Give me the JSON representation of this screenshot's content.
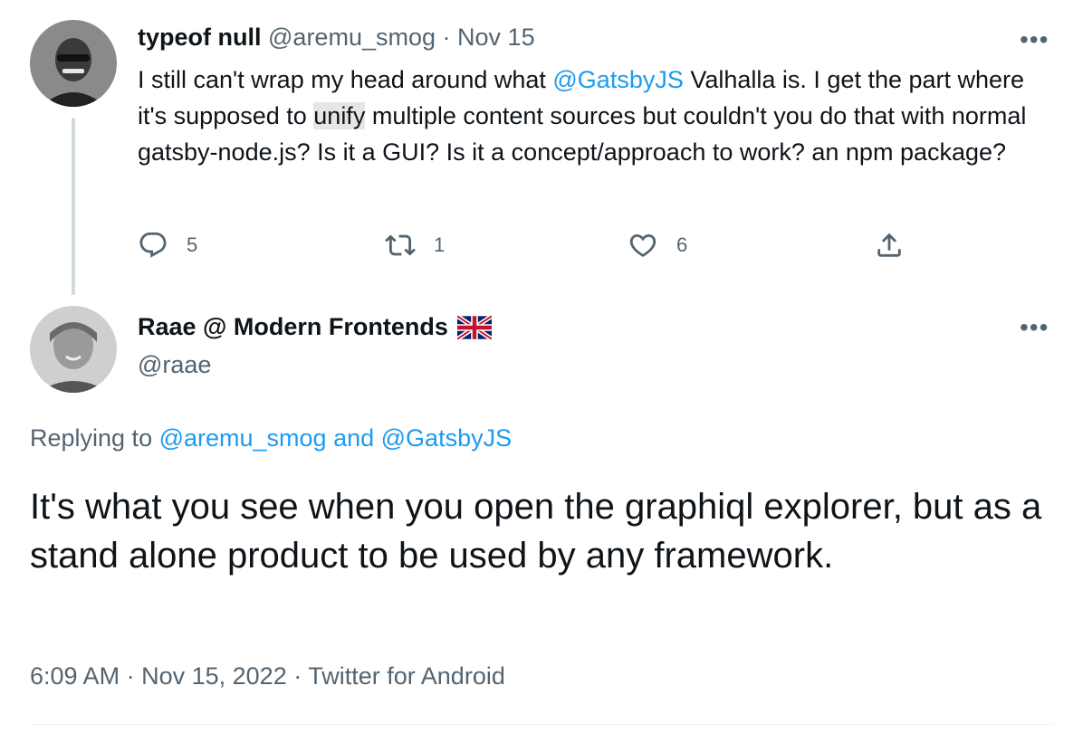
{
  "tweet1": {
    "author_name": "typeof null",
    "handle": "@aremu_smog",
    "separator": "·",
    "date": "Nov 15",
    "text_before": "I still can't wrap my head around what ",
    "mention": "@GatsbyJS",
    "text_mid": " Valhalla is. I get the part where it's supposed to ",
    "highlighted_word": "unify",
    "text_after": " multiple content sources but couldn't you do that with normal gatsby-node.js? Is it a GUI? Is it a concept/approach to work? an npm package?",
    "replies": "5",
    "retweets": "1",
    "likes": "6"
  },
  "tweet2": {
    "author_name": "Raae @ Modern Frontends",
    "flag": "🇬🇧",
    "handle": "@raae",
    "replying_prefix": "Replying to ",
    "replying_to_1": "@aremu_smog",
    "replying_and": " and ",
    "replying_to_2": "@GatsbyJS",
    "text": "It's what you see when you open the graphiql explorer, but as a stand alone product to be used by any framework.",
    "time": "6:09 AM",
    "separator": "·",
    "date": "Nov 15, 2022",
    "source": "Twitter for Android"
  },
  "more_menu": "•••",
  "icons": {
    "reply": "reply-icon",
    "retweet": "retweet-icon",
    "like": "heart-icon",
    "share": "share-icon",
    "flag": "uk-flag-icon"
  },
  "colors": {
    "link": "#1d9bf0",
    "muted": "#536471",
    "text": "#0f1419"
  }
}
